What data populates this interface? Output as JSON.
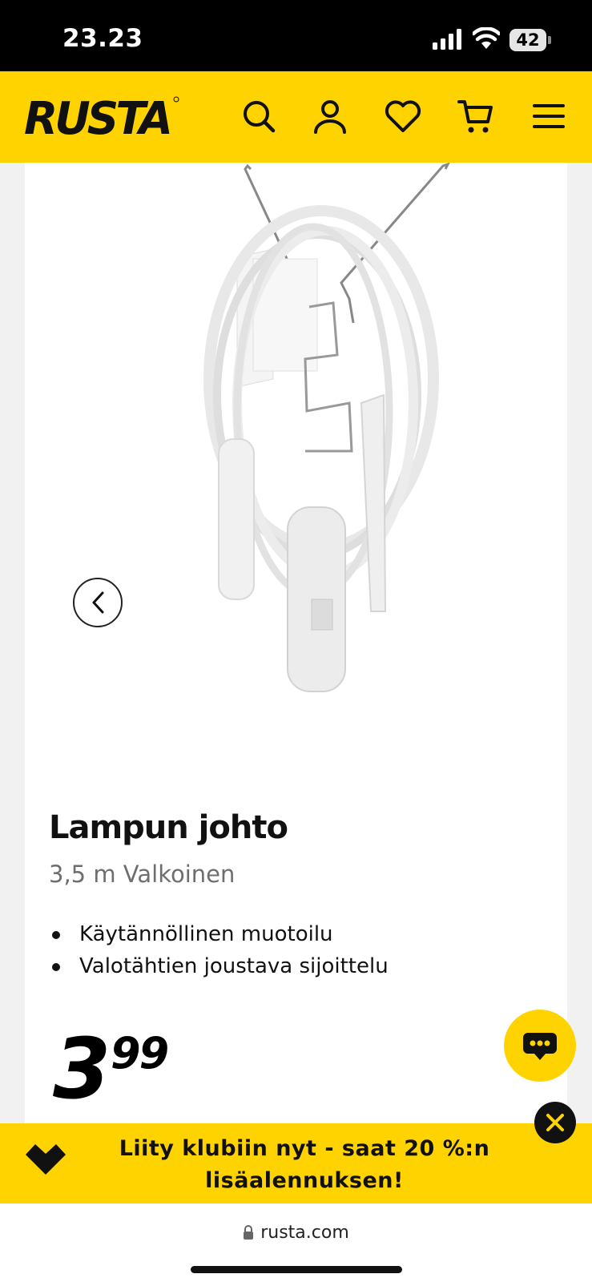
{
  "status_bar": {
    "time": "23.23",
    "battery": "42"
  },
  "header": {
    "logo_text": "RUSTA",
    "icons": [
      "search-icon",
      "account-icon",
      "heart-icon",
      "cart-icon",
      "menu-icon"
    ]
  },
  "product": {
    "title": "Lampun johto",
    "subtitle": "3,5 m Valkoinen",
    "features": [
      "Käytännöllinen muotoilu",
      "Valotähtien joustava sijoittelu"
    ],
    "price_integer": "3",
    "price_decimals": "99"
  },
  "club_banner": {
    "text": "Liity klubiin nyt - saat 20 %:n lisäalennuksen!"
  },
  "browser": {
    "url": "rusta.com"
  },
  "colors": {
    "brand_yellow": "#ffd300",
    "text_dark": "#111111"
  }
}
